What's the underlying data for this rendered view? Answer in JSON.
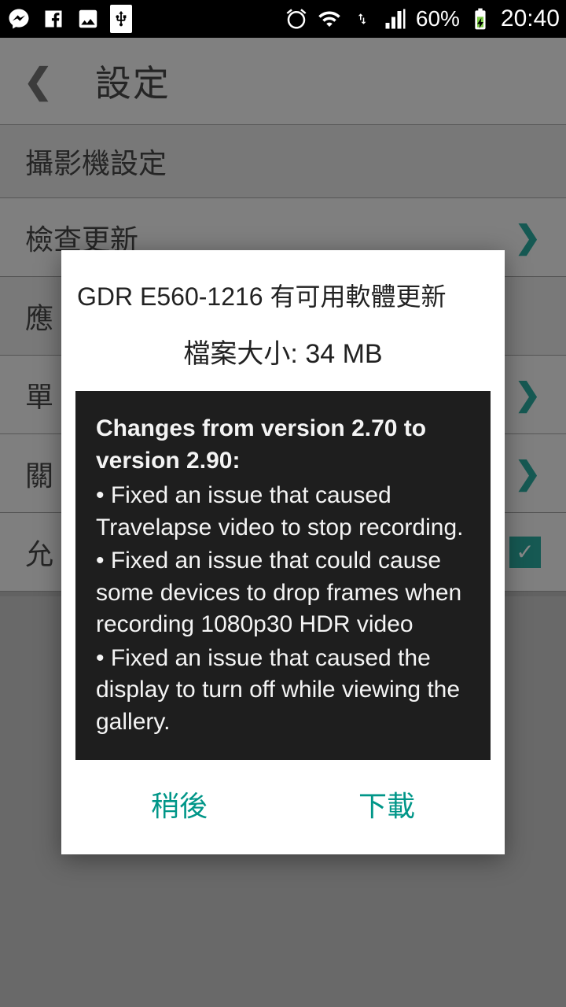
{
  "status": {
    "battery": "60%",
    "time": "20:40"
  },
  "header": {
    "title": "設定"
  },
  "section_camera": "攝影機設定",
  "rows": {
    "check_update": "檢查更新",
    "app": "應",
    "single": "單",
    "about": "關",
    "allow": "允"
  },
  "dialog": {
    "title": "GDR E560-1216 有可用軟體更新",
    "filesize_label": "檔案大小:",
    "filesize_value": "34 MB",
    "changes_heading": "Changes from version 2.70 to version 2.90:",
    "bullet1": "• Fixed an issue that caused Travelapse video to stop recording.",
    "bullet2": "• Fixed an issue that could cause some devices to drop frames when recording 1080p30 HDR video",
    "bullet3": "• Fixed an issue that caused the display to turn off while viewing the gallery.",
    "later": "稍後",
    "download": "下載"
  }
}
